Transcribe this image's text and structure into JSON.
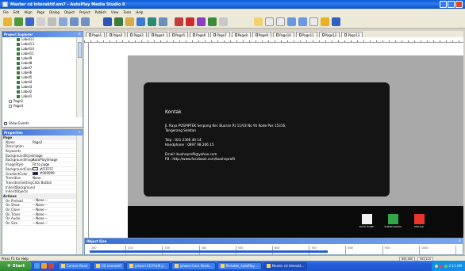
{
  "window": {
    "title": "Master cd interaktif.am7 - AutoPlay Media Studio 8"
  },
  "menu": [
    "File",
    "Edit",
    "Align",
    "Page",
    "Dialog",
    "Object",
    "Project",
    "Publish",
    "View",
    "Tools",
    "Help"
  ],
  "explorer": {
    "title": "Project Explorer",
    "items": [
      "Label12",
      "Label13",
      "Label14",
      "Label11",
      "Label9",
      "Label8",
      "Label7",
      "Label6",
      "Label5",
      "Label4",
      "Label3",
      "Label2",
      "Label1",
      "Page2",
      "Page3"
    ],
    "show_events": "Show Events"
  },
  "properties": {
    "title": "Properties",
    "rows": [
      {
        "k": "Page",
        "v": "",
        "section": true
      },
      {
        "k": "Name",
        "v": "Page2"
      },
      {
        "k": "Description",
        "v": ""
      },
      {
        "k": "Keywords",
        "v": ""
      },
      {
        "k": "BackgroundStyle",
        "v": "Image"
      },
      {
        "k": "BackgroundImage",
        "v": "AutoPlay\\Image"
      },
      {
        "k": "ImageStyle",
        "v": "Fit to page"
      },
      {
        "k": "BackgroundColor",
        "v": "#FFFFFF",
        "swatch": "#ffffff"
      },
      {
        "k": "GradientColor",
        "v": "#000099",
        "swatch": "#000099"
      },
      {
        "k": "Transition",
        "v": "None"
      },
      {
        "k": "TransitionSetting",
        "v": "Click Button"
      },
      {
        "k": "InheritBackground",
        "v": ""
      },
      {
        "k": "InheritObjects",
        "v": ""
      },
      {
        "k": "Actions",
        "v": "",
        "section": true
      },
      {
        "k": "On Preload",
        "v": "-- None --"
      },
      {
        "k": "On Show",
        "v": "-- None --"
      },
      {
        "k": "On Close",
        "v": "-- None --"
      },
      {
        "k": "On Timer",
        "v": "-- None --"
      },
      {
        "k": "On Audio",
        "v": "-- None --"
      },
      {
        "k": "On Size",
        "v": "-- None --"
      }
    ]
  },
  "tabs": [
    "Page1",
    "Page2",
    "Page3",
    "Page4",
    "Page5",
    "Page6",
    "Page7",
    "Page8",
    "Page9",
    "Page10",
    "Page11",
    "Page12",
    "Page13"
  ],
  "page": {
    "heading": "Kontak",
    "address1": "Jl. Raya PUSPIPTEK Serpong Kel. Buaran Rt 11/03 No 91 Kode Pos 15316,",
    "address2": "Tangerang Selatan",
    "telp": "Telp : 021 2366 40 14",
    "handphone": "Handphone : 0897 98 206 15",
    "email": "Email: buahnprofil@yahoo.com",
    "fb": "FB   : http://www.facebook.com/buahnprofil",
    "nav": [
      {
        "label": "BACK HOME",
        "color": "#f2f2f2"
      },
      {
        "label": "SUBPROGRAM",
        "color": "#35a348"
      },
      {
        "label": "KELUAR",
        "color": "#e8352b"
      }
    ]
  },
  "object_size": {
    "title": "Object Size",
    "ticks": [
      "100",
      "200",
      "300",
      "400",
      "500",
      "600",
      "700",
      "800",
      "900",
      "1000"
    ]
  },
  "status": {
    "left": "Press F1 for Help",
    "f1": "800,460",
    "f2": "593,115"
  },
  "taskbar": {
    "start": "Start",
    "tasks": [
      "Control Panel",
      "CD interaktif",
      "juhaeri CD Profil p...",
      "juhaeri-Cara Pemb...",
      "Portable_AutoPlay ...",
      "Master cd interakt..."
    ],
    "time": "2:11 AM"
  }
}
